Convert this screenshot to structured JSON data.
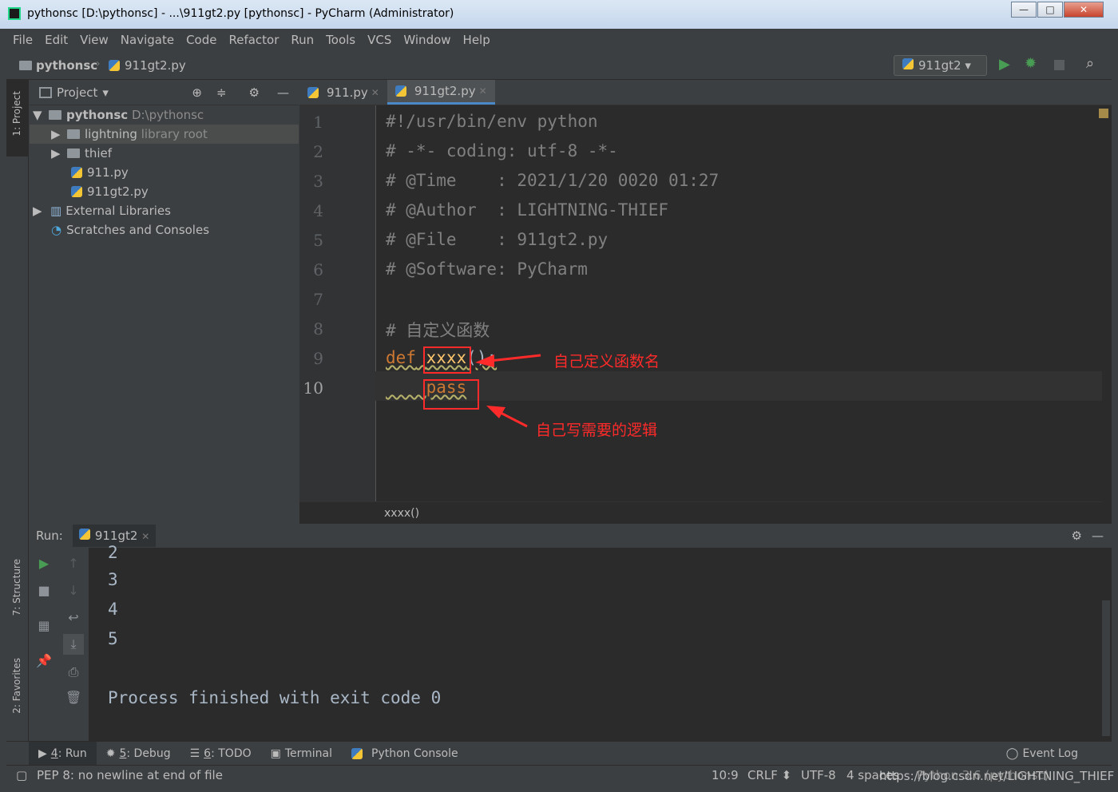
{
  "window": {
    "title": "pythonsc [D:\\pythonsc] - ...\\911gt2.py [pythonsc] - PyCharm (Administrator)",
    "minimize": "—",
    "maximize": "□",
    "close": "✕"
  },
  "menu": [
    "File",
    "Edit",
    "View",
    "Navigate",
    "Code",
    "Refactor",
    "Run",
    "Tools",
    "VCS",
    "Window",
    "Help"
  ],
  "breadcrumb": {
    "project": "pythonsc",
    "file": "911gt2.py"
  },
  "run_config": "911gt2",
  "left_strip": {
    "project": "1: Project",
    "structure": "7: Structure",
    "favorites": "2: Favorites"
  },
  "project_panel": {
    "title": "Project",
    "tree": [
      {
        "name": "pythonsc",
        "extra": "D:\\pythonsc",
        "type": "root"
      },
      {
        "name": "lightning",
        "extra": "library root",
        "type": "folder"
      },
      {
        "name": "thief",
        "extra": "",
        "type": "folder"
      },
      {
        "name": "911.py",
        "extra": "",
        "type": "py"
      },
      {
        "name": "911gt2.py",
        "extra": "",
        "type": "py"
      },
      {
        "name": "External Libraries",
        "extra": "",
        "type": "lib"
      },
      {
        "name": "Scratches and Consoles",
        "extra": "",
        "type": "scratch"
      }
    ]
  },
  "editor": {
    "tabs": [
      {
        "label": "911.py",
        "active": false
      },
      {
        "label": "911gt2.py",
        "active": true
      }
    ],
    "lines": [
      "#!/usr/bin/env python",
      "# -*- coding: utf-8 -*-",
      "# @Time    : 2021/1/20 0020 01:27",
      "# @Author  : LIGHTNING-THIEF",
      "# @File    : 911gt2.py",
      "# @Software: PyCharm",
      "",
      "# 自定义函数",
      "def xxxx():",
      "    pass"
    ],
    "line_numbers": [
      "1",
      "2",
      "3",
      "4",
      "5",
      "6",
      "7",
      "8",
      "9",
      "10"
    ],
    "breadcrumb": "xxxx()",
    "annotations": [
      "自己定义函数名",
      "自己写需要的逻辑"
    ]
  },
  "run_panel": {
    "label": "Run:",
    "tab": "911gt2",
    "output": [
      "2",
      "3",
      "4",
      "5",
      "",
      "Process finished with exit code 0"
    ]
  },
  "bottom_tabs": [
    {
      "key": "4",
      "label": ": Run"
    },
    {
      "key": "5",
      "label": ": Debug"
    },
    {
      "key": "6",
      "label": ": TODO"
    },
    {
      "key": "",
      "label": "Terminal"
    },
    {
      "key": "",
      "label": "Python Console"
    }
  ],
  "event_log": "Event Log",
  "status": {
    "message": "PEP 8: no newline at end of file",
    "position": "10:9",
    "line_sep": "CRLF",
    "encoding": "UTF-8",
    "indent": "4 spaces",
    "interpreter": "Python 3.6 (pythonsc)",
    "watermark": "https://blog.csdn.net/LIGHTNING_THIEF"
  },
  "colors": {
    "keyword": "#cc7832",
    "function": "#ffc66d",
    "comment": "#808080",
    "annotation": "#ff2a2a",
    "run_green": "#499c54"
  }
}
